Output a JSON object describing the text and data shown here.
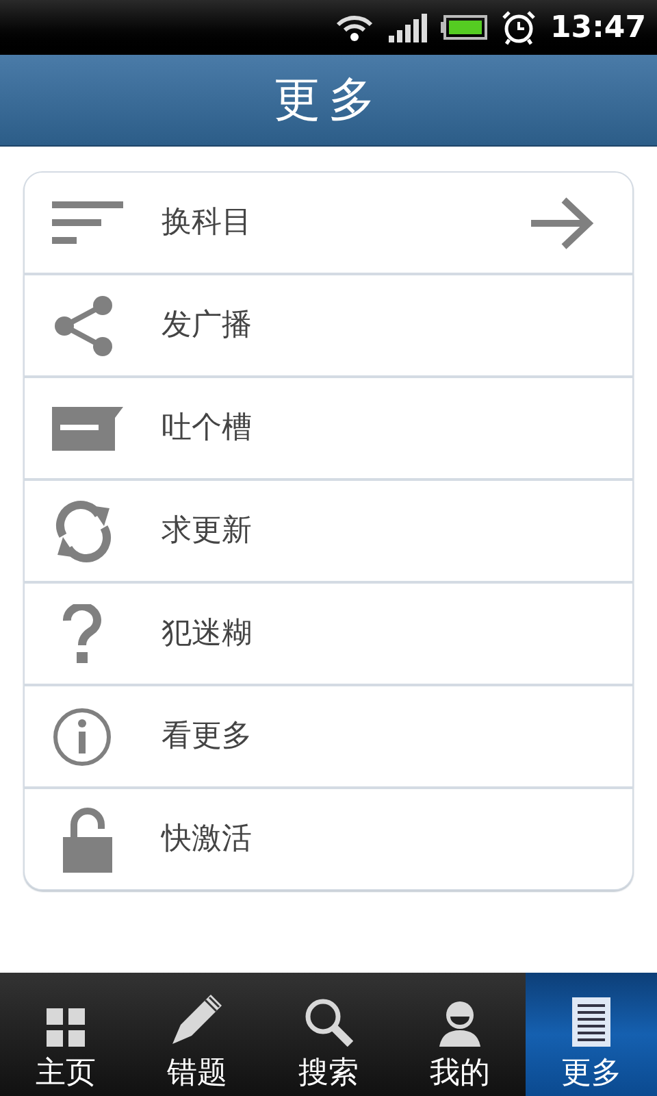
{
  "status_bar": {
    "time": "13:47"
  },
  "title": "更多",
  "menu": [
    {
      "label": "换科目",
      "kind": "lines",
      "arrow": true
    },
    {
      "label": "发广播",
      "kind": "share",
      "arrow": false
    },
    {
      "label": "吐个槽",
      "kind": "message",
      "arrow": false
    },
    {
      "label": "求更新",
      "kind": "refresh",
      "arrow": false
    },
    {
      "label": "犯迷糊",
      "kind": "question",
      "arrow": false
    },
    {
      "label": "看更多",
      "kind": "info",
      "arrow": false
    },
    {
      "label": "快激活",
      "kind": "lock",
      "arrow": false
    }
  ],
  "tabs": [
    {
      "label": "主页",
      "kind": "grid",
      "selected": false
    },
    {
      "label": "错题",
      "kind": "pencil",
      "selected": false
    },
    {
      "label": "搜索",
      "kind": "search",
      "selected": false
    },
    {
      "label": "我的",
      "kind": "person",
      "selected": false
    },
    {
      "label": "更多",
      "kind": "document",
      "selected": true
    }
  ]
}
